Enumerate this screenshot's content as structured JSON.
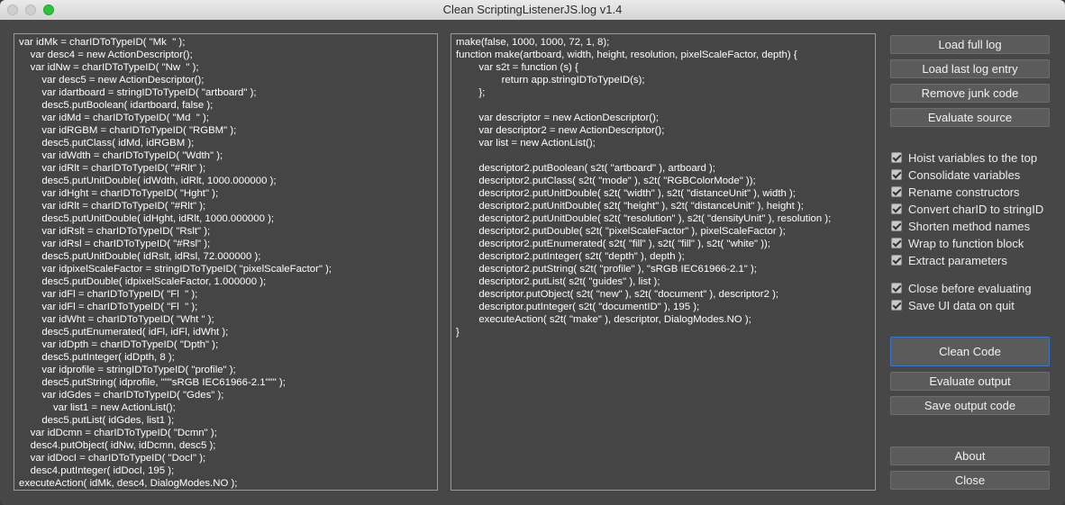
{
  "window": {
    "title": "Clean ScriptingListenerJS.log v1.4"
  },
  "left_code": [
    "var idMk = charIDToTypeID( \"Mk  \" );",
    "    var desc4 = new ActionDescriptor();",
    "    var idNw = charIDToTypeID( \"Nw  \" );",
    "        var desc5 = new ActionDescriptor();",
    "        var idartboard = stringIDToTypeID( \"artboard\" );",
    "        desc5.putBoolean( idartboard, false );",
    "        var idMd = charIDToTypeID( \"Md  \" );",
    "        var idRGBM = charIDToTypeID( \"RGBM\" );",
    "        desc5.putClass( idMd, idRGBM );",
    "        var idWdth = charIDToTypeID( \"Wdth\" );",
    "        var idRlt = charIDToTypeID( \"#Rlt\" );",
    "        desc5.putUnitDouble( idWdth, idRlt, 1000.000000 );",
    "        var idHght = charIDToTypeID( \"Hght\" );",
    "        var idRlt = charIDToTypeID( \"#Rlt\" );",
    "        desc5.putUnitDouble( idHght, idRlt, 1000.000000 );",
    "        var idRslt = charIDToTypeID( \"Rslt\" );",
    "        var idRsl = charIDToTypeID( \"#Rsl\" );",
    "        desc5.putUnitDouble( idRslt, idRsl, 72.000000 );",
    "        var idpixelScaleFactor = stringIDToTypeID( \"pixelScaleFactor\" );",
    "        desc5.putDouble( idpixelScaleFactor, 1.000000 );",
    "        var idFl = charIDToTypeID( \"Fl  \" );",
    "        var idFl = charIDToTypeID( \"Fl  \" );",
    "        var idWht = charIDToTypeID( \"Wht \" );",
    "        desc5.putEnumerated( idFl, idFl, idWht );",
    "        var idDpth = charIDToTypeID( \"Dpth\" );",
    "        desc5.putInteger( idDpth, 8 );",
    "        var idprofile = stringIDToTypeID( \"profile\" );",
    "        desc5.putString( idprofile, \"\"\"sRGB IEC61966-2.1\"\"\" );",
    "        var idGdes = charIDToTypeID( \"Gdes\" );",
    "            var list1 = new ActionList();",
    "        desc5.putList( idGdes, list1 );",
    "    var idDcmn = charIDToTypeID( \"Dcmn\" );",
    "    desc4.putObject( idNw, idDcmn, desc5 );",
    "    var idDocI = charIDToTypeID( \"DocI\" );",
    "    desc4.putInteger( idDocI, 195 );",
    "executeAction( idMk, desc4, DialogModes.NO );"
  ],
  "right_code": [
    "make(false, 1000, 1000, 72, 1, 8);",
    "function make(artboard, width, height, resolution, pixelScaleFactor, depth) {",
    "        var s2t = function (s) {",
    "                return app.stringIDToTypeID(s);",
    "        };",
    "",
    "        var descriptor = new ActionDescriptor();",
    "        var descriptor2 = new ActionDescriptor();",
    "        var list = new ActionList();",
    "",
    "        descriptor2.putBoolean( s2t( \"artboard\" ), artboard );",
    "        descriptor2.putClass( s2t( \"mode\" ), s2t( \"RGBColorMode\" ));",
    "        descriptor2.putUnitDouble( s2t( \"width\" ), s2t( \"distanceUnit\" ), width );",
    "        descriptor2.putUnitDouble( s2t( \"height\" ), s2t( \"distanceUnit\" ), height );",
    "        descriptor2.putUnitDouble( s2t( \"resolution\" ), s2t( \"densityUnit\" ), resolution );",
    "        descriptor2.putDouble( s2t( \"pixelScaleFactor\" ), pixelScaleFactor );",
    "        descriptor2.putEnumerated( s2t( \"fill\" ), s2t( \"fill\" ), s2t( \"white\" ));",
    "        descriptor2.putInteger( s2t( \"depth\" ), depth );",
    "        descriptor2.putString( s2t( \"profile\" ), \"sRGB IEC61966-2.1\" );",
    "        descriptor2.putList( s2t( \"guides\" ), list );",
    "        descriptor.putObject( s2t( \"new\" ), s2t( \"document\" ), descriptor2 );",
    "        descriptor.putInteger( s2t( \"documentID\" ), 195 );",
    "        executeAction( s2t( \"make\" ), descriptor, DialogModes.NO );",
    "}"
  ],
  "buttons": {
    "load_full_log": "Load full log",
    "load_last_entry": "Load last log entry",
    "remove_junk": "Remove junk code",
    "evaluate_source": "Evaluate source",
    "clean_code": "Clean Code",
    "evaluate_output": "Evaluate output",
    "save_output": "Save output code",
    "about": "About",
    "close": "Close"
  },
  "options": [
    {
      "label": "Hoist variables to the top",
      "checked": true
    },
    {
      "label": "Consolidate variables",
      "checked": true
    },
    {
      "label": "Rename constructors",
      "checked": true
    },
    {
      "label": "Convert charID to stringID",
      "checked": true
    },
    {
      "label": "Shorten method names",
      "checked": true
    },
    {
      "label": "Wrap to function block",
      "checked": true
    },
    {
      "label": "Extract parameters",
      "checked": true
    }
  ],
  "options2": [
    {
      "label": "Close before evaluating",
      "checked": true
    },
    {
      "label": "Save UI data on quit",
      "checked": true
    }
  ]
}
